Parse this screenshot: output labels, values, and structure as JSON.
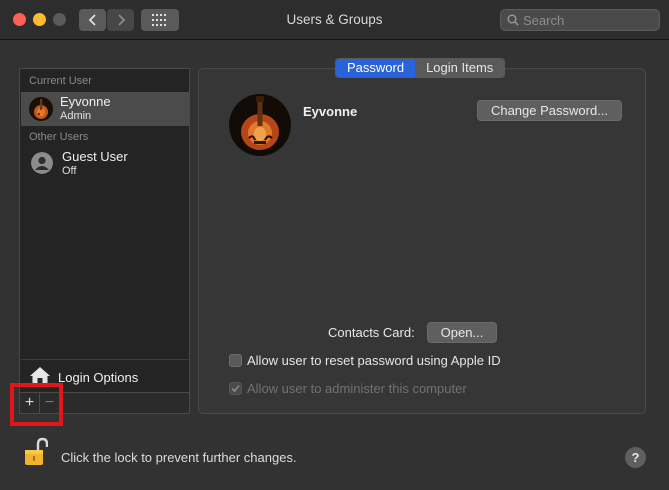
{
  "window": {
    "title": "Users & Groups",
    "search_placeholder": "Search"
  },
  "sidebar": {
    "current_user_label": "Current User",
    "other_users_label": "Other Users",
    "current_user": {
      "name": "Eyvonne",
      "role": "Admin"
    },
    "other_users": [
      {
        "name": "Guest User",
        "status": "Off"
      }
    ],
    "login_options_label": "Login Options",
    "add_label": "+",
    "remove_label": "−"
  },
  "tabs": [
    {
      "label": "Password",
      "active": true
    },
    {
      "label": "Login Items",
      "active": false
    }
  ],
  "panel": {
    "username": "Eyvonne",
    "change_password_label": "Change Password...",
    "contacts_card_label": "Contacts Card:",
    "open_label": "Open...",
    "checkboxes": [
      {
        "label": "Allow user to reset password using Apple ID",
        "checked": false,
        "enabled": true
      },
      {
        "label": "Allow user to administer this computer",
        "checked": true,
        "enabled": false
      }
    ]
  },
  "footer": {
    "lock_text": "Click the lock to prevent further changes.",
    "help_label": "?"
  },
  "colors": {
    "accent": "#2a63d9",
    "highlight_box": "#e0161b",
    "close": "#fc5f57",
    "minimize": "#fdbc2e"
  },
  "icons": [
    "chevron-left-icon",
    "chevron-right-icon",
    "grid-icon",
    "search-icon",
    "house-icon",
    "guest-user-icon",
    "lock-open-icon",
    "help-icon"
  ]
}
